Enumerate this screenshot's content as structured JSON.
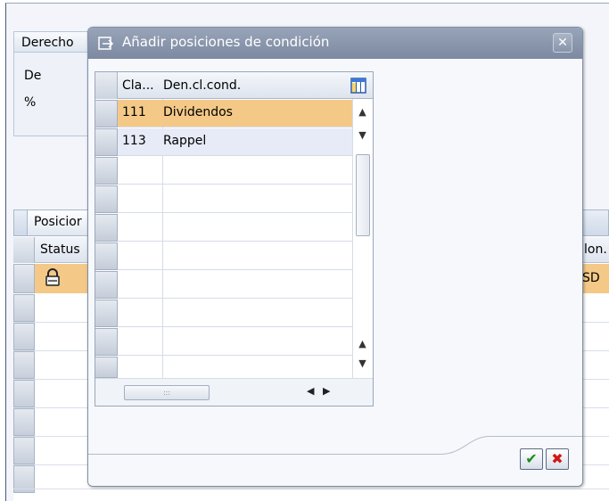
{
  "background": {
    "group_title": "Derecho",
    "field_labels": [
      "De",
      "%"
    ],
    "tab_label": "Posicior",
    "table_headers": {
      "status": "Status",
      "right_col": "lon."
    },
    "row": {
      "right_value": "SD"
    }
  },
  "dialog": {
    "title": "Añadir posiciones de condición",
    "close_label": "✕",
    "table": {
      "columns": {
        "cla": "Cla...",
        "den": "Den.cl.cond."
      },
      "rows": [
        {
          "cla": "111",
          "den": "Dividendos",
          "selected": true
        },
        {
          "cla": "113",
          "den": "Rappel",
          "selected": false
        }
      ],
      "empty_rows": 7,
      "scroll_up_glyph": "▲",
      "scroll_down_glyph": "▼",
      "scroll_left_glyph": "◀",
      "scroll_right_glyph": "▶",
      "h_grip": ":::"
    },
    "ok_glyph": "✔",
    "cancel_glyph": "✖"
  },
  "colors": {
    "selected_row": "#f4c987",
    "second_row": "#e6ebf7",
    "title_bar": "#8a96ad"
  }
}
